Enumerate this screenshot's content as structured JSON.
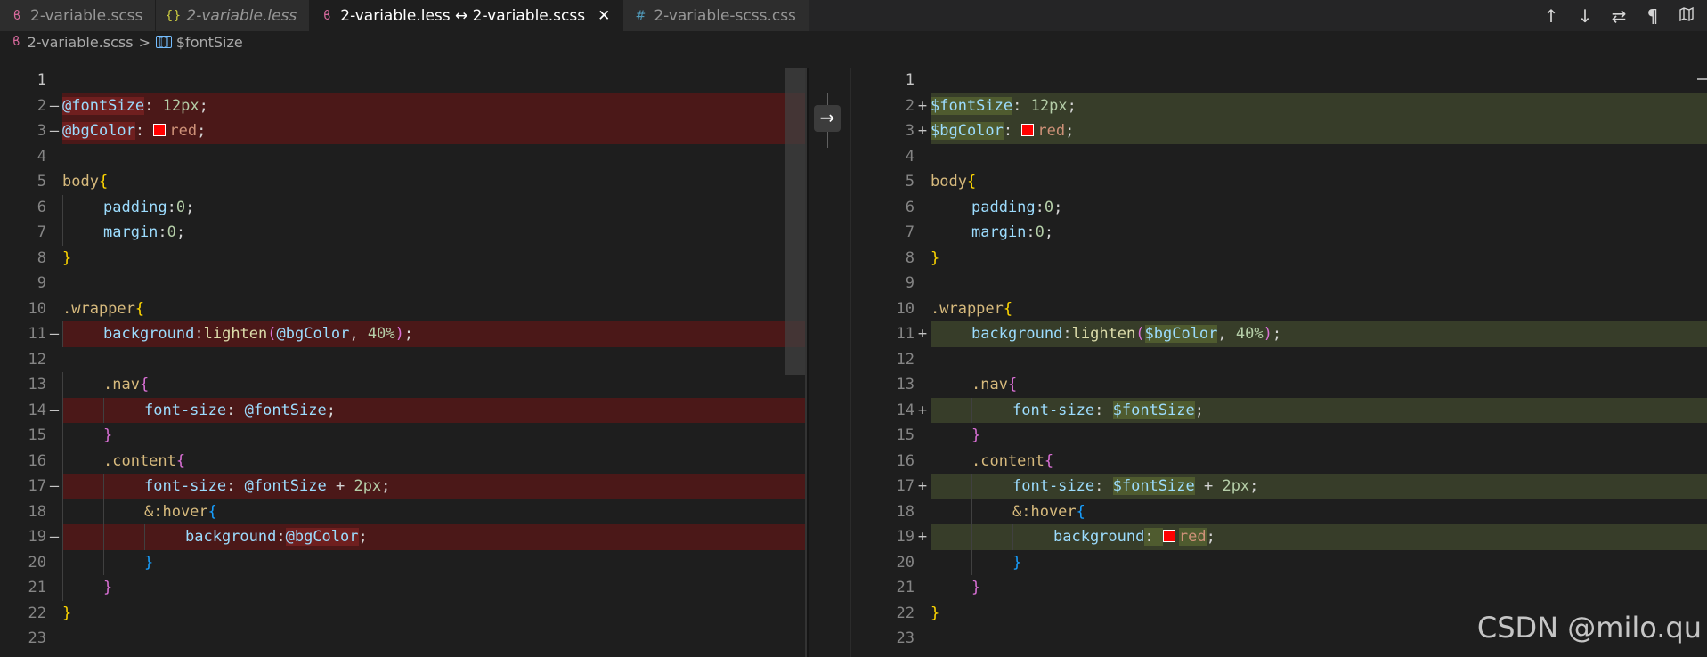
{
  "tabs": [
    {
      "icon": "sass-icon",
      "label": "2-variable.scss",
      "italic": false,
      "active": false
    },
    {
      "icon": "braces-icon",
      "label": "2-variable.less",
      "italic": true,
      "active": false
    },
    {
      "icon": "sass-icon",
      "label": "2-variable.less ↔ 2-variable.scss",
      "italic": false,
      "active": true
    },
    {
      "icon": "hash-icon",
      "label": "2-variable-scss.css",
      "italic": false,
      "active": false
    }
  ],
  "icons": {
    "sass_glyph": "ϐ",
    "braces_glyph": "{}",
    "hash_glyph": "#",
    "close_glyph": "✕",
    "var_glyph": "⟦⟧",
    "arrow_right_glyph": "→"
  },
  "toolbar": {
    "prev_change": "↑",
    "next_change": "↓",
    "swap_sides": "⇄",
    "toggle_whitespace": "¶",
    "toggle_minimap": "🗺"
  },
  "breadcrumb": {
    "file": "2-variable.scss",
    "separator": ">",
    "symbol": "$fontSize"
  },
  "watermark": "CSDN @milo.qu",
  "colors": {
    "deleted_bg": "#4b1818",
    "inserted_bg": "#373d29",
    "swatch": "#ff0000"
  },
  "left_lines": [
    {
      "n": "1",
      "mark": "",
      "kind": "",
      "tokens": []
    },
    {
      "n": "2",
      "mark": "—",
      "kind": "del",
      "tokens": [
        [
          "@fontSize",
          "t-var hl-del"
        ],
        [
          ": ",
          "t-pun"
        ],
        [
          "12px",
          "t-num"
        ],
        [
          ";",
          "t-pun"
        ]
      ]
    },
    {
      "n": "3",
      "mark": "—",
      "kind": "del",
      "tokens": [
        [
          "@bgColor",
          "t-var hl-del"
        ],
        [
          ": ",
          "t-pun"
        ],
        [
          "#swatch",
          ""
        ],
        [
          "red",
          "t-val"
        ],
        [
          ";",
          "t-pun"
        ]
      ]
    },
    {
      "n": "4",
      "mark": "",
      "kind": "",
      "tokens": []
    },
    {
      "n": "5",
      "mark": "",
      "kind": "",
      "tokens": [
        [
          "body",
          "t-sel"
        ],
        [
          "{",
          "b1"
        ]
      ]
    },
    {
      "n": "6",
      "mark": "",
      "kind": "",
      "tokens": [
        [
          "#guide",
          ""
        ],
        [
          "padding",
          "t-prop"
        ],
        [
          ":",
          "t-pun"
        ],
        [
          "0",
          "t-num"
        ],
        [
          ";",
          "t-pun"
        ]
      ]
    },
    {
      "n": "7",
      "mark": "",
      "kind": "",
      "tokens": [
        [
          "#guide",
          ""
        ],
        [
          "margin",
          "t-prop"
        ],
        [
          ":",
          "t-pun"
        ],
        [
          "0",
          "t-num"
        ],
        [
          ";",
          "t-pun"
        ]
      ]
    },
    {
      "n": "8",
      "mark": "",
      "kind": "",
      "tokens": [
        [
          "}",
          "b1"
        ]
      ]
    },
    {
      "n": "9",
      "mark": "",
      "kind": "",
      "tokens": []
    },
    {
      "n": "10",
      "mark": "",
      "kind": "",
      "tokens": [
        [
          ".wrapper",
          "t-sel"
        ],
        [
          "{",
          "b1"
        ]
      ]
    },
    {
      "n": "11",
      "mark": "—",
      "kind": "del",
      "tokens": [
        [
          "#guide",
          ""
        ],
        [
          "background",
          "t-prop"
        ],
        [
          ":",
          "t-pun"
        ],
        [
          "lighten",
          "t-fn"
        ],
        [
          "(",
          "b2"
        ],
        [
          "@bgColor",
          "t-var"
        ],
        [
          ", ",
          "t-pun"
        ],
        [
          "40%",
          "t-num"
        ],
        [
          ")",
          "b2"
        ],
        [
          ";",
          "t-pun"
        ]
      ]
    },
    {
      "n": "12",
      "mark": "",
      "kind": "",
      "tokens": []
    },
    {
      "n": "13",
      "mark": "",
      "kind": "",
      "tokens": [
        [
          "#guide",
          ""
        ],
        [
          ".nav",
          "t-sel"
        ],
        [
          "{",
          "b2"
        ]
      ]
    },
    {
      "n": "14",
      "mark": "—",
      "kind": "del",
      "tokens": [
        [
          "#guide",
          ""
        ],
        [
          "#guide",
          ""
        ],
        [
          "font-size",
          "t-prop"
        ],
        [
          ": ",
          "t-pun"
        ],
        [
          "@fontSize",
          "t-var"
        ],
        [
          ";",
          "t-pun"
        ]
      ]
    },
    {
      "n": "15",
      "mark": "",
      "kind": "",
      "tokens": [
        [
          "#guide",
          ""
        ],
        [
          "}",
          "b2"
        ]
      ]
    },
    {
      "n": "16",
      "mark": "",
      "kind": "",
      "tokens": [
        [
          "#guide",
          ""
        ],
        [
          ".content",
          "t-sel"
        ],
        [
          "{",
          "b2"
        ]
      ]
    },
    {
      "n": "17",
      "mark": "—",
      "kind": "del",
      "tokens": [
        [
          "#guide",
          ""
        ],
        [
          "#guide",
          ""
        ],
        [
          "font-size",
          "t-prop"
        ],
        [
          ": ",
          "t-pun"
        ],
        [
          "@fontSize",
          "t-var"
        ],
        [
          " + ",
          "t-pun"
        ],
        [
          "2px",
          "t-num"
        ],
        [
          ";",
          "t-pun"
        ]
      ]
    },
    {
      "n": "18",
      "mark": "",
      "kind": "",
      "tokens": [
        [
          "#guide",
          ""
        ],
        [
          "#guide",
          ""
        ],
        [
          "&:hover",
          "t-sel"
        ],
        [
          "{",
          "b3"
        ]
      ]
    },
    {
      "n": "19",
      "mark": "—",
      "kind": "del",
      "tokens": [
        [
          "#guide",
          ""
        ],
        [
          "#guide",
          ""
        ],
        [
          "#guide",
          ""
        ],
        [
          "background",
          "t-prop"
        ],
        [
          ":",
          "t-pun"
        ],
        [
          "@bgColor",
          "t-var hl-del"
        ],
        [
          ";",
          "t-pun"
        ]
      ]
    },
    {
      "n": "20",
      "mark": "",
      "kind": "",
      "tokens": [
        [
          "#guide",
          ""
        ],
        [
          "#guide",
          ""
        ],
        [
          "}",
          "b3"
        ]
      ]
    },
    {
      "n": "21",
      "mark": "",
      "kind": "",
      "tokens": [
        [
          "#guide",
          ""
        ],
        [
          "}",
          "b2"
        ]
      ]
    },
    {
      "n": "22",
      "mark": "",
      "kind": "",
      "tokens": [
        [
          "}",
          "b1"
        ]
      ]
    },
    {
      "n": "23",
      "mark": "",
      "kind": "",
      "tokens": []
    }
  ],
  "right_lines": [
    {
      "n": "1",
      "mark": "",
      "kind": "",
      "tokens": []
    },
    {
      "n": "2",
      "mark": "+",
      "kind": "ins",
      "tokens": [
        [
          "$fontSize",
          "t-var hl-ins"
        ],
        [
          ": ",
          "t-pun"
        ],
        [
          "12px",
          "t-num"
        ],
        [
          ";",
          "t-pun"
        ]
      ]
    },
    {
      "n": "3",
      "mark": "+",
      "kind": "ins",
      "tokens": [
        [
          "$bgColor",
          "t-var hl-ins"
        ],
        [
          ": ",
          "t-pun"
        ],
        [
          "#swatch",
          ""
        ],
        [
          "red",
          "t-val"
        ],
        [
          ";",
          "t-pun"
        ]
      ]
    },
    {
      "n": "4",
      "mark": "",
      "kind": "",
      "tokens": []
    },
    {
      "n": "5",
      "mark": "",
      "kind": "",
      "tokens": [
        [
          "body",
          "t-sel"
        ],
        [
          "{",
          "b1"
        ]
      ]
    },
    {
      "n": "6",
      "mark": "",
      "kind": "",
      "tokens": [
        [
          "#guide",
          ""
        ],
        [
          "padding",
          "t-prop"
        ],
        [
          ":",
          "t-pun"
        ],
        [
          "0",
          "t-num"
        ],
        [
          ";",
          "t-pun"
        ]
      ]
    },
    {
      "n": "7",
      "mark": "",
      "kind": "",
      "tokens": [
        [
          "#guide",
          ""
        ],
        [
          "margin",
          "t-prop"
        ],
        [
          ":",
          "t-pun"
        ],
        [
          "0",
          "t-num"
        ],
        [
          ";",
          "t-pun"
        ]
      ]
    },
    {
      "n": "8",
      "mark": "",
      "kind": "",
      "tokens": [
        [
          "}",
          "b1"
        ]
      ]
    },
    {
      "n": "9",
      "mark": "",
      "kind": "",
      "tokens": []
    },
    {
      "n": "10",
      "mark": "",
      "kind": "",
      "tokens": [
        [
          ".wrapper",
          "t-sel"
        ],
        [
          "{",
          "b1"
        ]
      ]
    },
    {
      "n": "11",
      "mark": "+",
      "kind": "ins",
      "tokens": [
        [
          "#guide",
          ""
        ],
        [
          "background",
          "t-prop"
        ],
        [
          ":",
          "t-pun"
        ],
        [
          "lighten",
          "t-fn"
        ],
        [
          "(",
          "b2"
        ],
        [
          "$bgColor",
          "t-var hl-ins"
        ],
        [
          ", ",
          "t-pun"
        ],
        [
          "40%",
          "t-num"
        ],
        [
          ")",
          "b2"
        ],
        [
          ";",
          "t-pun"
        ]
      ]
    },
    {
      "n": "12",
      "mark": "",
      "kind": "",
      "tokens": []
    },
    {
      "n": "13",
      "mark": "",
      "kind": "",
      "tokens": [
        [
          "#guide",
          ""
        ],
        [
          ".nav",
          "t-sel"
        ],
        [
          "{",
          "b2"
        ]
      ]
    },
    {
      "n": "14",
      "mark": "+",
      "kind": "ins",
      "tokens": [
        [
          "#guide",
          ""
        ],
        [
          "#guide",
          ""
        ],
        [
          "font-size",
          "t-prop"
        ],
        [
          ": ",
          "t-pun"
        ],
        [
          "$fontSize",
          "t-var hl-ins"
        ],
        [
          ";",
          "t-pun"
        ]
      ]
    },
    {
      "n": "15",
      "mark": "",
      "kind": "",
      "tokens": [
        [
          "#guide",
          ""
        ],
        [
          "}",
          "b2"
        ]
      ]
    },
    {
      "n": "16",
      "mark": "",
      "kind": "",
      "tokens": [
        [
          "#guide",
          ""
        ],
        [
          ".content",
          "t-sel"
        ],
        [
          "{",
          "b2"
        ]
      ]
    },
    {
      "n": "17",
      "mark": "+",
      "kind": "ins",
      "tokens": [
        [
          "#guide",
          ""
        ],
        [
          "#guide",
          ""
        ],
        [
          "font-size",
          "t-prop"
        ],
        [
          ": ",
          "t-pun"
        ],
        [
          "$fontSize",
          "t-var hl-ins"
        ],
        [
          " + ",
          "t-pun"
        ],
        [
          "2px",
          "t-num"
        ],
        [
          ";",
          "t-pun"
        ]
      ]
    },
    {
      "n": "18",
      "mark": "",
      "kind": "",
      "tokens": [
        [
          "#guide",
          ""
        ],
        [
          "#guide",
          ""
        ],
        [
          "&:hover",
          "t-sel"
        ],
        [
          "{",
          "b3"
        ]
      ]
    },
    {
      "n": "19",
      "mark": "+",
      "kind": "ins",
      "tokens": [
        [
          "#guide",
          ""
        ],
        [
          "#guide",
          ""
        ],
        [
          "#guide",
          ""
        ],
        [
          "background",
          "t-prop"
        ],
        [
          ": ",
          "t-pun hl-ins"
        ],
        [
          "#swatch",
          ""
        ],
        [
          "red",
          "t-val hl-ins"
        ],
        [
          ";",
          "t-pun"
        ]
      ]
    },
    {
      "n": "20",
      "mark": "",
      "kind": "",
      "tokens": [
        [
          "#guide",
          ""
        ],
        [
          "#guide",
          ""
        ],
        [
          "}",
          "b3"
        ]
      ]
    },
    {
      "n": "21",
      "mark": "",
      "kind": "",
      "tokens": [
        [
          "#guide",
          ""
        ],
        [
          "}",
          "b2"
        ]
      ]
    },
    {
      "n": "22",
      "mark": "",
      "kind": "",
      "tokens": [
        [
          "}",
          "b1"
        ]
      ]
    },
    {
      "n": "23",
      "mark": "",
      "kind": "",
      "tokens": []
    }
  ]
}
